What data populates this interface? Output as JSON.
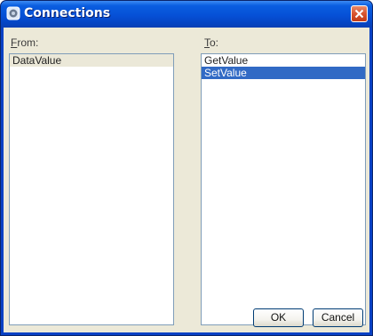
{
  "window": {
    "title": "Connections"
  },
  "from": {
    "label_accel": "F",
    "label_rest": "rom:",
    "items": [
      {
        "label": "DataValue",
        "state": "highlighted"
      }
    ]
  },
  "to": {
    "label_accel": "T",
    "label_rest": "o:",
    "items": [
      {
        "label": "GetValue",
        "state": "normal"
      },
      {
        "label": "SetValue",
        "state": "selected"
      }
    ]
  },
  "buttons": {
    "ok": "OK",
    "cancel": "Cancel"
  },
  "colors": {
    "title_bar": "#0650d6",
    "selection": "#316ac5",
    "dialog_bg": "#ece9d8",
    "close_button": "#d8542f"
  },
  "icons": {
    "app": "connections-icon",
    "close": "close-icon"
  }
}
